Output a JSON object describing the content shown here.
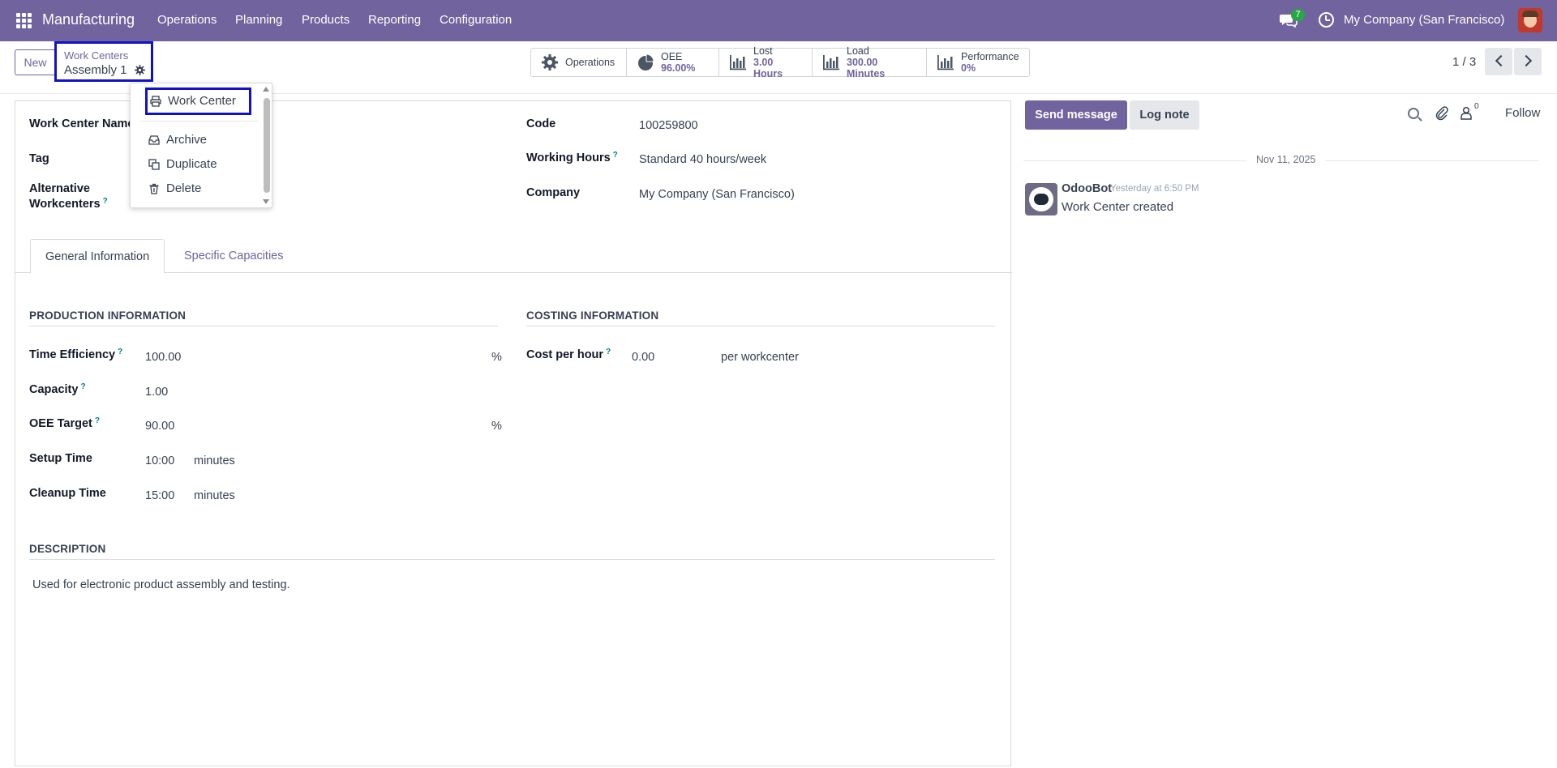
{
  "navbar": {
    "app_name": "Manufacturing",
    "menu": [
      "Operations",
      "Planning",
      "Products",
      "Reporting",
      "Configuration"
    ],
    "chat_badge": "7",
    "company": "My Company (San Francisco)"
  },
  "control_panel": {
    "new_label": "New",
    "breadcrumb_parent": "Work Centers",
    "breadcrumb_current": "Assembly 1",
    "smart_buttons": [
      {
        "label": "Operations",
        "value": "",
        "icon": "gear-icon"
      },
      {
        "label": "OEE",
        "value": "96.00%",
        "icon": "pie-chart-icon"
      },
      {
        "label": "Lost",
        "value": "3.00 Hours",
        "icon": "bar-chart-icon"
      },
      {
        "label": "Load",
        "value": "300.00 Minutes",
        "icon": "bar-chart-icon"
      },
      {
        "label": "Performance",
        "value": "0%",
        "icon": "bar-chart-icon"
      }
    ],
    "pager": "1 / 3"
  },
  "dropdown": {
    "print_item": "Work Center",
    "items": [
      "Archive",
      "Duplicate",
      "Delete"
    ]
  },
  "form": {
    "left_fields": {
      "work_center_name_label": "Work Center Name",
      "tag_label": "Tag",
      "alternative_label_1": "Alternative",
      "alternative_label_2": "Workcenters"
    },
    "right_fields": {
      "code_label": "Code",
      "code_value": "100259800",
      "working_hours_label": "Working Hours",
      "working_hours_value": "Standard 40 hours/week",
      "company_label": "Company",
      "company_value": "My Company (San Francisco)"
    },
    "tabs": [
      "General Information",
      "Specific Capacities"
    ],
    "production": {
      "title": "PRODUCTION INFORMATION",
      "time_efficiency_label": "Time Efficiency",
      "time_efficiency_value": "100.00",
      "time_efficiency_unit": "%",
      "capacity_label": "Capacity",
      "capacity_value": "1.00",
      "oee_target_label": "OEE Target",
      "oee_target_value": "90.00",
      "oee_target_unit": "%",
      "setup_time_label": "Setup Time",
      "setup_time_value": "10:00",
      "setup_time_unit": "minutes",
      "cleanup_time_label": "Cleanup Time",
      "cleanup_time_value": "15:00",
      "cleanup_time_unit": "minutes"
    },
    "costing": {
      "title": "COSTING INFORMATION",
      "cost_label": "Cost per hour",
      "cost_value": "0.00",
      "cost_unit": "per workcenter"
    },
    "description": {
      "title": "DESCRIPTION",
      "text": "Used for electronic product assembly and testing."
    },
    "help_mark": "?"
  },
  "chatter": {
    "send_message": "Send message",
    "log_note": "Log note",
    "follower_count": "0",
    "follow": "Follow",
    "date": "Nov 11, 2025",
    "message": {
      "author": "OdooBot",
      "time": "Yesterday at 6:50 PM",
      "body": "Work Center created"
    }
  },
  "colors": {
    "brand": "#71639e",
    "highlight_border": "#1212c4",
    "help": "#017e84",
    "badge": "#28a745"
  }
}
